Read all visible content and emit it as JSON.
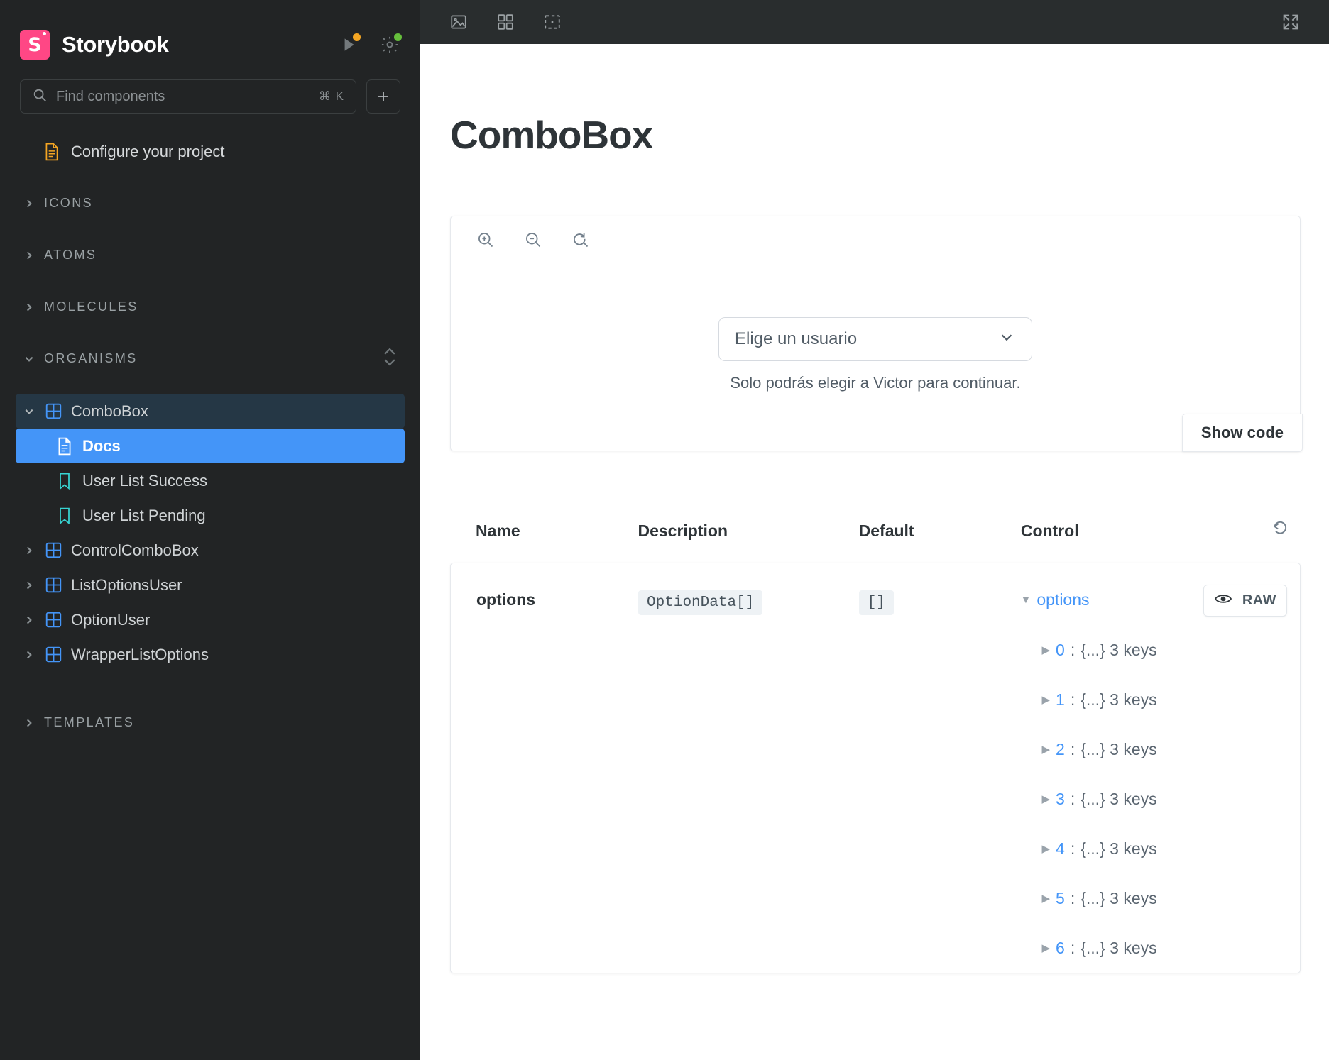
{
  "sidebar": {
    "brand": "Storybook",
    "brand_mark": "S",
    "header_icons": [
      {
        "name": "play-shortcuts-icon",
        "badge": "#f5a623"
      },
      {
        "name": "gear-settings-icon",
        "badge": "#66bf3c"
      }
    ],
    "search": {
      "placeholder": "Find components",
      "shortcut": "⌘ K",
      "icon": "search-icon"
    },
    "add_button": {
      "icon": "plus-icon",
      "label": "+"
    },
    "configure_item": {
      "label": "Configure your project",
      "icon": "document-icon"
    },
    "groups": [
      {
        "label": "ICONS",
        "expanded": false
      },
      {
        "label": "ATOMS",
        "expanded": false
      },
      {
        "label": "MOLECULES",
        "expanded": false
      },
      {
        "label": "ORGANISMS",
        "expanded": true
      },
      {
        "label": "TEMPLATES",
        "expanded": false
      }
    ],
    "organisms": [
      {
        "label": "ComboBox",
        "icon": "component-grid-icon",
        "expanded": true,
        "state": "parent-selected"
      },
      {
        "label": "Docs",
        "icon": "docs-page-icon",
        "state": "selected",
        "indent": 1
      },
      {
        "label": "User List Success",
        "icon": "story-bookmark-icon",
        "state": "normal",
        "indent": 1
      },
      {
        "label": "User List Pending",
        "icon": "story-bookmark-icon",
        "state": "normal",
        "indent": 1
      },
      {
        "label": "ControlComboBox",
        "icon": "component-grid-icon",
        "expanded": false,
        "state": "normal"
      },
      {
        "label": "ListOptionsUser",
        "icon": "component-grid-icon",
        "expanded": false,
        "state": "normal"
      },
      {
        "label": "OptionUser",
        "icon": "component-grid-icon",
        "expanded": false,
        "state": "normal"
      },
      {
        "label": "WrapperListOptions",
        "icon": "component-grid-icon",
        "expanded": false,
        "state": "normal"
      }
    ]
  },
  "toolbar": {
    "buttons": [
      {
        "name": "photo-backgrounds-icon"
      },
      {
        "name": "grid-layout-icon"
      },
      {
        "name": "measure-outline-icon"
      }
    ],
    "fullscreen": {
      "name": "expand-fullscreen-icon"
    }
  },
  "docs": {
    "title": "ComboBox",
    "preview_toolbar": [
      {
        "name": "zoom-in-icon"
      },
      {
        "name": "zoom-out-icon"
      },
      {
        "name": "zoom-reset-icon"
      }
    ],
    "story": {
      "combobox_value": "Elige un usuario",
      "chevron": "chevron-down-icon",
      "help_text": "Solo podrás elegir a Victor para continuar."
    },
    "show_code_label": "Show code"
  },
  "args_table": {
    "headers": {
      "name": "Name",
      "description": "Description",
      "default": "Default",
      "control": "Control",
      "reset_icon": "reset-controls-icon"
    },
    "rows": [
      {
        "name": "options",
        "description": "OptionData[]",
        "default": "[]",
        "control": {
          "root_label": "options",
          "eye_icon": "eye-visibility-icon",
          "raw_label": "RAW",
          "items": [
            {
              "index": "0",
              "value": "{...} 3 keys"
            },
            {
              "index": "1",
              "value": "{...} 3 keys"
            },
            {
              "index": "2",
              "value": "{...} 3 keys"
            },
            {
              "index": "3",
              "value": "{...} 3 keys"
            },
            {
              "index": "4",
              "value": "{...} 3 keys"
            },
            {
              "index": "5",
              "value": "{...} 3 keys"
            },
            {
              "index": "6",
              "value": "{...} 3 keys"
            }
          ]
        }
      }
    ]
  },
  "colors": {
    "brand_pink": "#ff4785",
    "selected_blue": "#4495f8",
    "parent_selected": "#253745",
    "sidebar_bg": "#222425",
    "toolbar_bg": "#292d2e",
    "story_icon": "#37d5d3",
    "component_icon": "#4495f8",
    "docs_icon": "#f5a623"
  }
}
